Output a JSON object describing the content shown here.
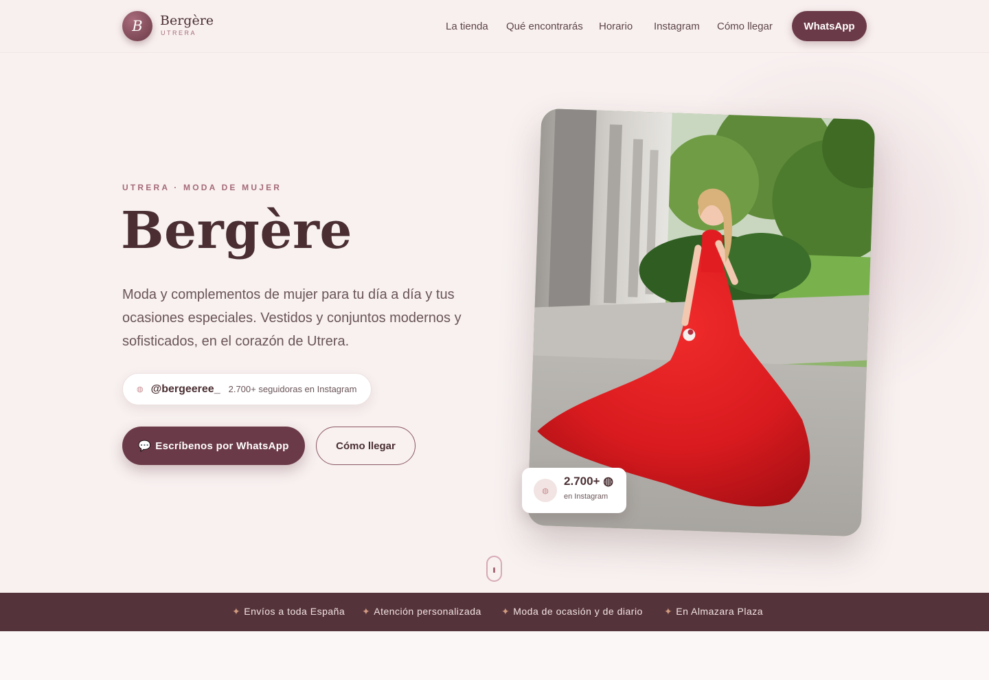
{
  "brand": {
    "initial": "B",
    "name": "Bergère",
    "sub": "UTRERA"
  },
  "nav": {
    "items": [
      "La tienda",
      "Qué encontrarás",
      "Horario",
      "Instagram",
      "Cómo llegar"
    ],
    "cta": "WhatsApp"
  },
  "hero": {
    "eyebrow": "UTRERA · MODA DE MUJER",
    "title": "Bergère",
    "description": "Moda y complementos de mujer para tu día a día y tus ocasiones especiales. Vestidos y conjuntos modernos y sofisticados, en el corazón de Utrera.",
    "instagram": {
      "icon": "◍",
      "handle": "@bergeeree_",
      "followers": "2.700+ seguidoras en Instagram"
    },
    "buttons": {
      "whatsapp": "Escríbenos por WhatsApp",
      "whatsapp_icon": "💬",
      "directions": "Cómo llegar"
    },
    "stat": {
      "value": "2.700+ ◍",
      "label": "en Instagram",
      "icon": "◍"
    }
  },
  "ribbon": {
    "items": [
      "Envíos a toda España",
      "Atención personalizada",
      "Moda de ocasión y de diario",
      "En Almazara Plaza"
    ],
    "icon": "✦"
  },
  "colors": {
    "accent": "#6b3a48",
    "ribbon": "#55333a",
    "background": "#f8f1f0"
  }
}
